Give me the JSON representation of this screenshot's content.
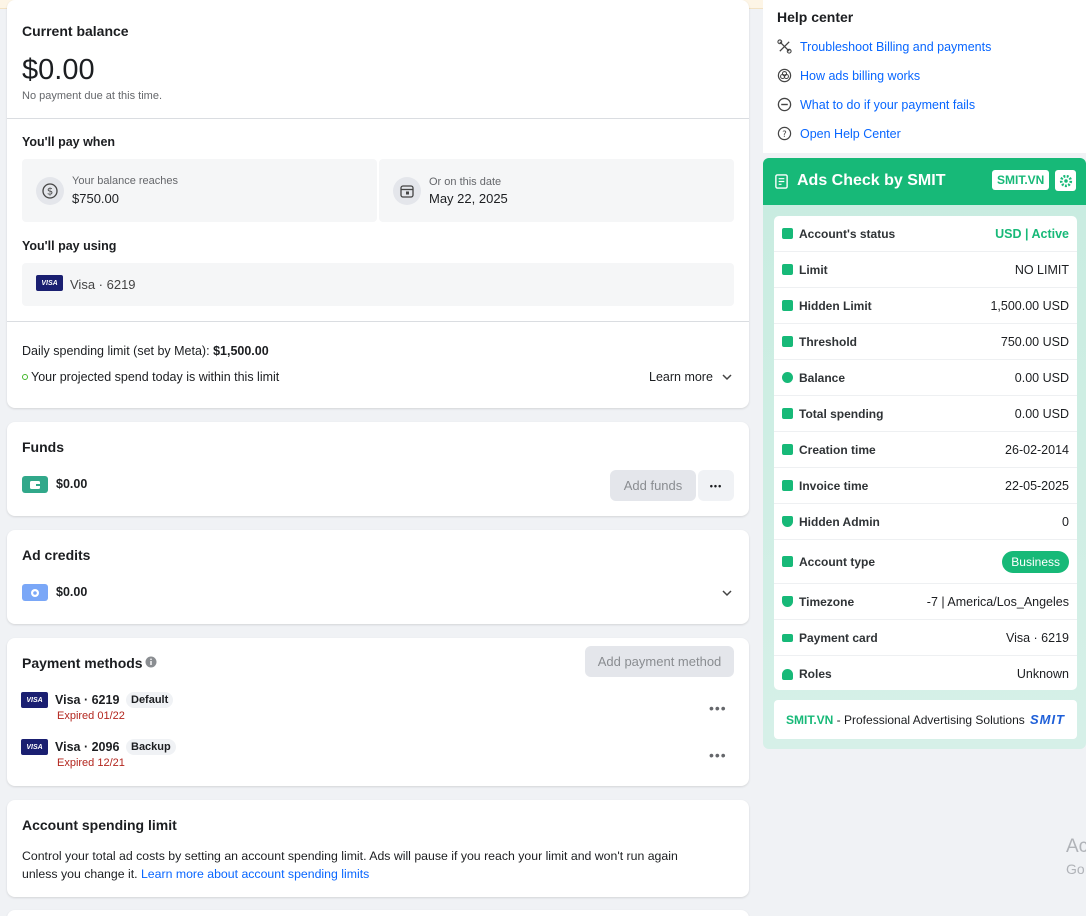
{
  "balance": {
    "title": "Current balance",
    "amount": "$0.00",
    "note": "No payment due at this time.",
    "pay_when_title": "You'll pay when",
    "reaches_label": "Your balance reaches",
    "reaches_value": "$750.00",
    "date_label": "Or on this date",
    "date_value": "May 22, 2025",
    "pay_using_title": "You'll pay using",
    "pay_using_card": "Visa · 6219",
    "daily_limit_label": "Daily spending limit (set by Meta):",
    "daily_limit_value": "$1,500.00",
    "projected": "Your projected spend today is within this limit",
    "learn_more": "Learn more"
  },
  "funds": {
    "title": "Funds",
    "amount": "$0.00",
    "add_funds": "Add funds",
    "more": "•••"
  },
  "ad_credits": {
    "title": "Ad credits",
    "amount": "$0.00"
  },
  "payment_methods": {
    "title": "Payment methods",
    "add_button": "Add payment method",
    "visa_logo": "VISA",
    "cards": [
      {
        "name": "Visa · 6219",
        "badge": "Default",
        "expiry": "Expired 01/22"
      },
      {
        "name": "Visa · 2096",
        "badge": "Backup",
        "expiry": "Expired 12/21"
      }
    ]
  },
  "spending_limit": {
    "title": "Account spending limit",
    "desc_line1": "Control your total ad costs by setting an account spending limit. Ads will pause if you reach your limit and won't run again",
    "desc_line2": "unless you change it.",
    "link": "Learn more about account spending limits"
  },
  "help": {
    "title": "Help center",
    "links": [
      "Troubleshoot Billing and payments",
      "How ads billing works",
      "What to do if your payment fails",
      "Open Help Center"
    ]
  },
  "smit": {
    "title": "Ads Check by SMIT",
    "tag": "SMIT.VN",
    "rows": [
      {
        "key": "Account's status",
        "value": "USD | Active"
      },
      {
        "key": "Limit",
        "value": "NO LIMIT"
      },
      {
        "key": "Hidden Limit",
        "value": "1,500.00 USD"
      },
      {
        "key": "Threshold",
        "value": "750.00 USD"
      },
      {
        "key": "Balance",
        "value": "0.00 USD"
      },
      {
        "key": "Total spending",
        "value": "0.00 USD"
      },
      {
        "key": "Creation time",
        "value": "26-02-2014"
      },
      {
        "key": "Invoice time",
        "value": "22-05-2025"
      },
      {
        "key": "Hidden Admin",
        "value": "0"
      },
      {
        "key": "Account type",
        "value": "Business"
      },
      {
        "key": "Timezone",
        "value": "-7 | America/Los_Angeles"
      },
      {
        "key": "Payment card",
        "value": "Visa · 6219"
      },
      {
        "key": "Roles",
        "value": "Unknown"
      }
    ],
    "footer_brand": "SMIT.VN",
    "footer_text": " - Professional Advertising Solutions",
    "footer_logo": "SMIT"
  },
  "watermark": {
    "line1": "Ac",
    "line2": "Go"
  },
  "colors": {
    "accent": "#17b978",
    "link": "#0866ff",
    "expired": "#b3261e"
  }
}
